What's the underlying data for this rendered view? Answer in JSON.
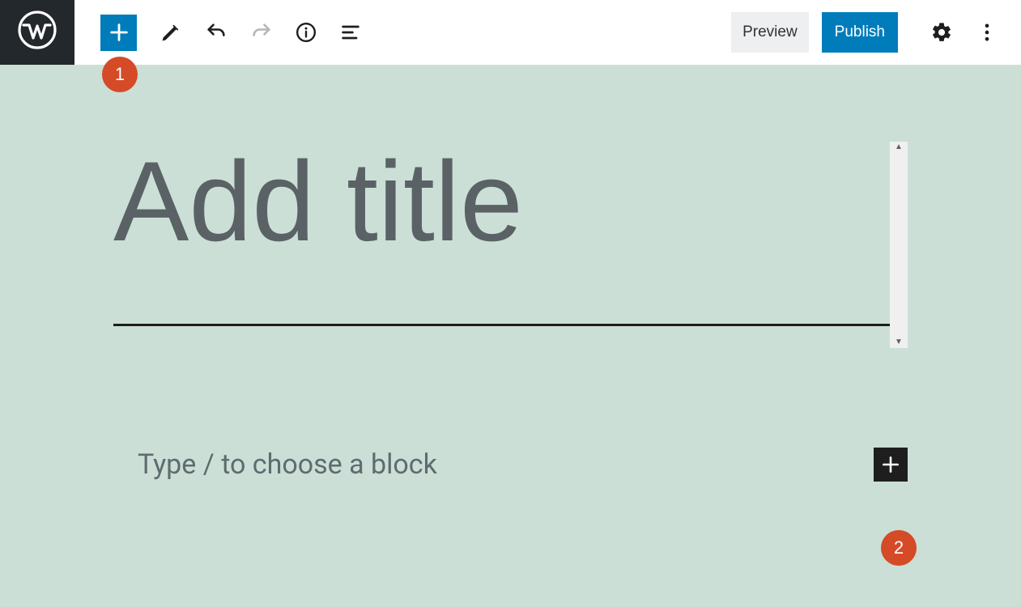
{
  "topbar": {
    "preview_label": "Preview",
    "publish_label": "Publish"
  },
  "editor": {
    "title_placeholder": "Add title",
    "block_placeholder": "Type / to choose a block"
  },
  "annotations": {
    "one": "1",
    "two": "2"
  }
}
